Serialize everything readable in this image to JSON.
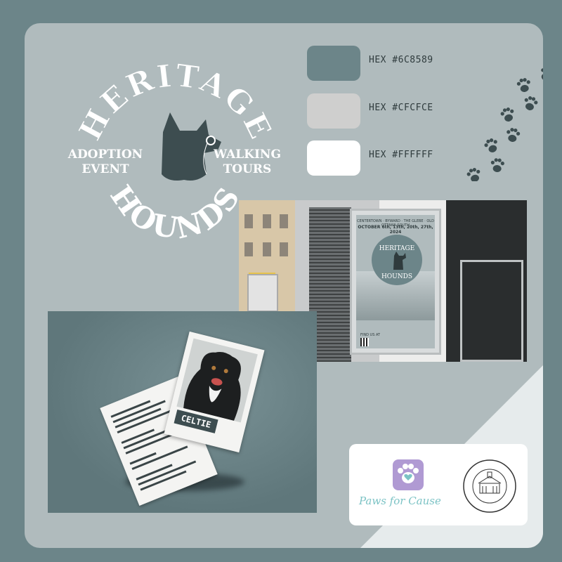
{
  "brand": {
    "title_top": "HERITAGE",
    "title_bottom": "HOUNDS",
    "left_text": [
      "ADOPTION",
      "EVENT"
    ],
    "right_text": [
      "WALKING",
      "TOURS"
    ]
  },
  "palette": [
    {
      "label": "HEX #6C8589",
      "color": "#6c8589"
    },
    {
      "label": "HEX #CFCFCE",
      "color": "#cfcfce"
    },
    {
      "label": "HEX #FFFFFF",
      "color": "#ffffff"
    }
  ],
  "poster": {
    "header": "CENTERTOWN · BYWARD · THE GLEBE · OLD OTTAWA SOUTH",
    "dates": "OCTOBER 6th, 13th, 20th, 27th, 2024",
    "find_us": "FIND US AT"
  },
  "dog_card": {
    "name": "CELTIE"
  },
  "partners": {
    "paws_for_cause": "Paws for Cause"
  },
  "colors": {
    "background": "#6c8589",
    "card": "#b0bbbd",
    "dark": "#3d4d50"
  }
}
